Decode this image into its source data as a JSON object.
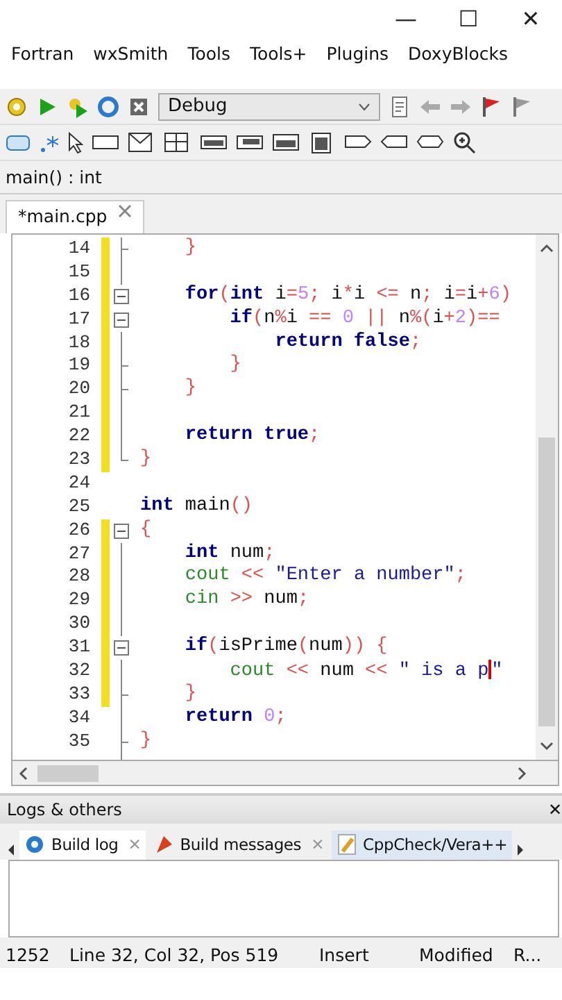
{
  "window": {
    "controls": [
      "—",
      "☐",
      "✕"
    ]
  },
  "menu": [
    "Fortran",
    "wxSmith",
    "Tools",
    "Tools+",
    "Plugins",
    "DoxyBlocks"
  ],
  "build_target": {
    "value": "Debug"
  },
  "symbol_bar": {
    "value": "main() : int"
  },
  "editor_tabs": [
    {
      "label": "*main.cpp",
      "selected": true
    }
  ],
  "code_lines": [
    {
      "number": "14",
      "kind": "fold-close",
      "changed": true,
      "tokens": [
        {
          "kind": "op",
          "text": "    }"
        }
      ]
    },
    {
      "number": "15",
      "kind": "fold-body",
      "changed": true
    },
    {
      "number": "16",
      "kind": "fold-start",
      "changed": true,
      "tokens": [
        {
          "kind": "kw",
          "text": "    for"
        },
        {
          "kind": "op",
          "text": "("
        },
        {
          "kind": "kw",
          "text": "int"
        },
        {
          "kind": "plain",
          "text": " i"
        },
        {
          "kind": "op",
          "text": "="
        },
        {
          "kind": "num",
          "text": "5"
        },
        {
          "kind": "op",
          "text": "; "
        },
        {
          "kind": "plain",
          "text": "i"
        },
        {
          "kind": "op",
          "text": "*"
        },
        {
          "kind": "plain",
          "text": "i "
        },
        {
          "kind": "op",
          "text": "<= "
        },
        {
          "kind": "plain",
          "text": "n"
        },
        {
          "kind": "op",
          "text": "; "
        },
        {
          "kind": "plain",
          "text": "i"
        },
        {
          "kind": "op",
          "text": "="
        },
        {
          "kind": "plain",
          "text": "i"
        },
        {
          "kind": "op",
          "text": "+"
        },
        {
          "kind": "num",
          "text": "6"
        },
        {
          "kind": "op",
          "text": ")"
        }
      ]
    },
    {
      "number": "17",
      "kind": "fold-start",
      "changed": true,
      "tokens": [
        {
          "kind": "kw",
          "text": "        if"
        },
        {
          "kind": "op",
          "text": "("
        },
        {
          "kind": "plain",
          "text": "n"
        },
        {
          "kind": "op",
          "text": "%"
        },
        {
          "kind": "plain",
          "text": "i "
        },
        {
          "kind": "op",
          "text": "== "
        },
        {
          "kind": "num",
          "text": "0 "
        },
        {
          "kind": "op",
          "text": "|| "
        },
        {
          "kind": "plain",
          "text": "n"
        },
        {
          "kind": "op",
          "text": "%("
        },
        {
          "kind": "plain",
          "text": "i"
        },
        {
          "kind": "op",
          "text": "+"
        },
        {
          "kind": "num",
          "text": "2"
        },
        {
          "kind": "op",
          "text": ")=="
        }
      ]
    },
    {
      "number": "18",
      "kind": "fold-body",
      "changed": true,
      "tokens": [
        {
          "kind": "kw",
          "text": "            return false"
        },
        {
          "kind": "op",
          "text": ";"
        }
      ]
    },
    {
      "number": "19",
      "kind": "fold-close",
      "changed": true,
      "tokens": [
        {
          "kind": "op",
          "text": "        }"
        }
      ]
    },
    {
      "number": "20",
      "kind": "fold-close",
      "changed": true,
      "tokens": [
        {
          "kind": "op",
          "text": "    }"
        }
      ]
    },
    {
      "number": "21",
      "kind": "fold-body",
      "changed": true
    },
    {
      "number": "22",
      "kind": "fold-body",
      "changed": true,
      "tokens": [
        {
          "kind": "kw",
          "text": "    return true"
        },
        {
          "kind": "op",
          "text": ";"
        }
      ]
    },
    {
      "number": "23",
      "kind": "fold-end",
      "changed": true,
      "tokens": [
        {
          "kind": "op",
          "text": "}"
        }
      ]
    },
    {
      "number": "24",
      "kind": "plain",
      "changed": false
    },
    {
      "number": "25",
      "kind": "plain",
      "changed": false,
      "tokens": [
        {
          "kind": "kw",
          "text": "int"
        },
        {
          "kind": "plain",
          "text": " main"
        },
        {
          "kind": "op",
          "text": "()"
        }
      ]
    },
    {
      "number": "26",
      "kind": "fold-start",
      "changed": true,
      "tokens": [
        {
          "kind": "op",
          "text": "{"
        }
      ]
    },
    {
      "number": "27",
      "kind": "fold-body",
      "changed": true,
      "tokens": [
        {
          "kind": "kw",
          "text": "    int"
        },
        {
          "kind": "plain",
          "text": " num"
        },
        {
          "kind": "op",
          "text": ";"
        }
      ]
    },
    {
      "number": "28",
      "kind": "fold-body",
      "changed": true,
      "tokens": [
        {
          "kind": "lib",
          "text": "    cout "
        },
        {
          "kind": "op",
          "text": "<< "
        },
        {
          "kind": "str",
          "text": "\"Enter a number\""
        },
        {
          "kind": "op",
          "text": ";"
        }
      ]
    },
    {
      "number": "29",
      "kind": "fold-body",
      "changed": true,
      "tokens": [
        {
          "kind": "lib",
          "text": "    cin "
        },
        {
          "kind": "op",
          "text": ">> "
        },
        {
          "kind": "plain",
          "text": "num"
        },
        {
          "kind": "op",
          "text": ";"
        }
      ]
    },
    {
      "number": "30",
      "kind": "fold-body",
      "changed": true
    },
    {
      "number": "31",
      "kind": "fold-start",
      "changed": true,
      "tokens": [
        {
          "kind": "kw",
          "text": "    if"
        },
        {
          "kind": "op",
          "text": "("
        },
        {
          "kind": "plain",
          "text": "isPrime"
        },
        {
          "kind": "op",
          "text": "("
        },
        {
          "kind": "plain",
          "text": "num"
        },
        {
          "kind": "op",
          "text": ")) {"
        }
      ]
    },
    {
      "number": "32",
      "kind": "fold-body",
      "changed": true,
      "tokens": [
        {
          "kind": "lib",
          "text": "        cout "
        },
        {
          "kind": "op",
          "text": "<< "
        },
        {
          "kind": "plain",
          "text": "num "
        },
        {
          "kind": "op",
          "text": "<< "
        },
        {
          "kind": "str",
          "text": "\" is a p"
        },
        {
          "kind": "caret"
        },
        {
          "kind": "str",
          "text": "\""
        }
      ]
    },
    {
      "number": "33",
      "kind": "fold-close",
      "changed": true,
      "tokens": [
        {
          "kind": "op",
          "text": "    }"
        }
      ]
    },
    {
      "number": "34",
      "kind": "fold-body",
      "changed": false,
      "tokens": [
        {
          "kind": "kw",
          "text": "    return "
        },
        {
          "kind": "num",
          "text": "0"
        },
        {
          "kind": "op",
          "text": ";"
        }
      ]
    },
    {
      "number": "35",
      "kind": "fold-close",
      "changed": false,
      "tokens": [
        {
          "kind": "op",
          "text": "}"
        }
      ]
    },
    {
      "kind": "fold-end",
      "changed": false
    }
  ],
  "logs_panel": {
    "title": "Logs & others",
    "close": "✕",
    "tabs": [
      {
        "label": "Build log",
        "selected": true,
        "close": "✕"
      },
      {
        "label": "Build messages",
        "selected": false,
        "close": "✕"
      },
      {
        "label": "CppCheck/Vera++",
        "selected": false
      }
    ]
  },
  "status_bar": [
    "1252",
    "Line 32, Col 32, Pos 519",
    "Insert",
    "Modified",
    "R..."
  ]
}
